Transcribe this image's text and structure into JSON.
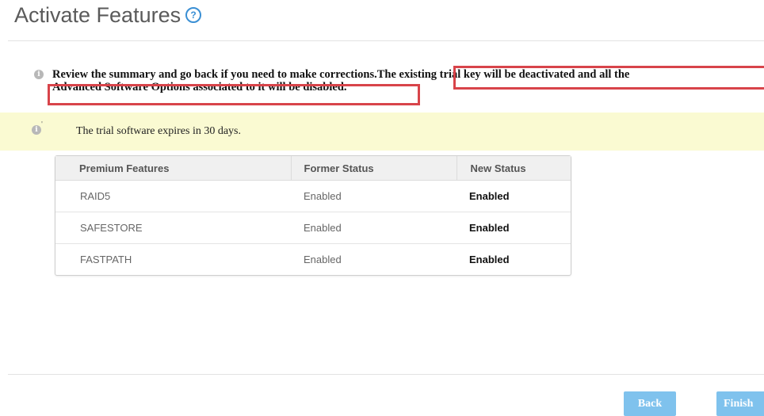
{
  "page": {
    "title": "Activate Features",
    "help_icon": "?"
  },
  "review": {
    "text_line1": "Review the summary and go back if you need to make corrections.",
    "text_highlight1": "The existing trial key will be deactivated and all the",
    "text_highlight2": "Advanced Software Options associated to it will be disabled.",
    "highlight_color": "#d8444a"
  },
  "banner": {
    "text": "The trial software expires in 30 days.",
    "tick": "'",
    "background": "#fafad2"
  },
  "table": {
    "headers": [
      "Premium Features",
      "Former Status",
      "New Status"
    ],
    "rows": [
      [
        "RAID5",
        "Enabled",
        "Enabled"
      ],
      [
        "SAFESTORE",
        "Enabled",
        "Enabled"
      ],
      [
        "FASTPATH",
        "Enabled",
        "Enabled"
      ]
    ]
  },
  "footer": {
    "back_label": "Back",
    "finish_label": "Finish",
    "button_color": "#7fc2ed"
  }
}
